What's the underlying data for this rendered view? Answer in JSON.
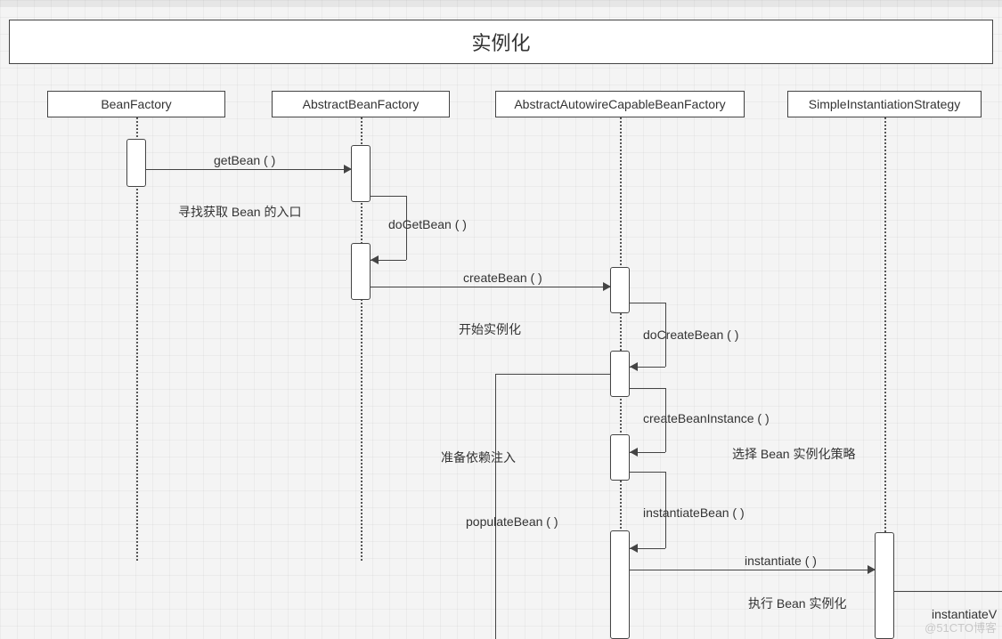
{
  "diagram": {
    "title": "实例化",
    "participants": {
      "p1": "BeanFactory",
      "p2": "AbstractBeanFactory",
      "p3": "AbstractAutowireCapableBeanFactory",
      "p4": "SimpleInstantiationStrategy"
    },
    "messages": {
      "m1": "getBean ( )",
      "m2": "doGetBean ( )",
      "m3": "createBean ( )",
      "m4": "doCreateBean ( )",
      "m5": "createBeanInstance ( )",
      "m6": "instantiateBean ( )",
      "m7": "populateBean ( )",
      "m8": "instantiate ( )",
      "m9": "instantiateV"
    },
    "notes": {
      "n1": "寻找获取 Bean 的入口",
      "n2": "开始实例化",
      "n3": "准备依赖注入",
      "n4": "选择 Bean 实例化策略",
      "n5": "执行 Bean 实例化"
    }
  },
  "watermark": "@51CTO博客"
}
